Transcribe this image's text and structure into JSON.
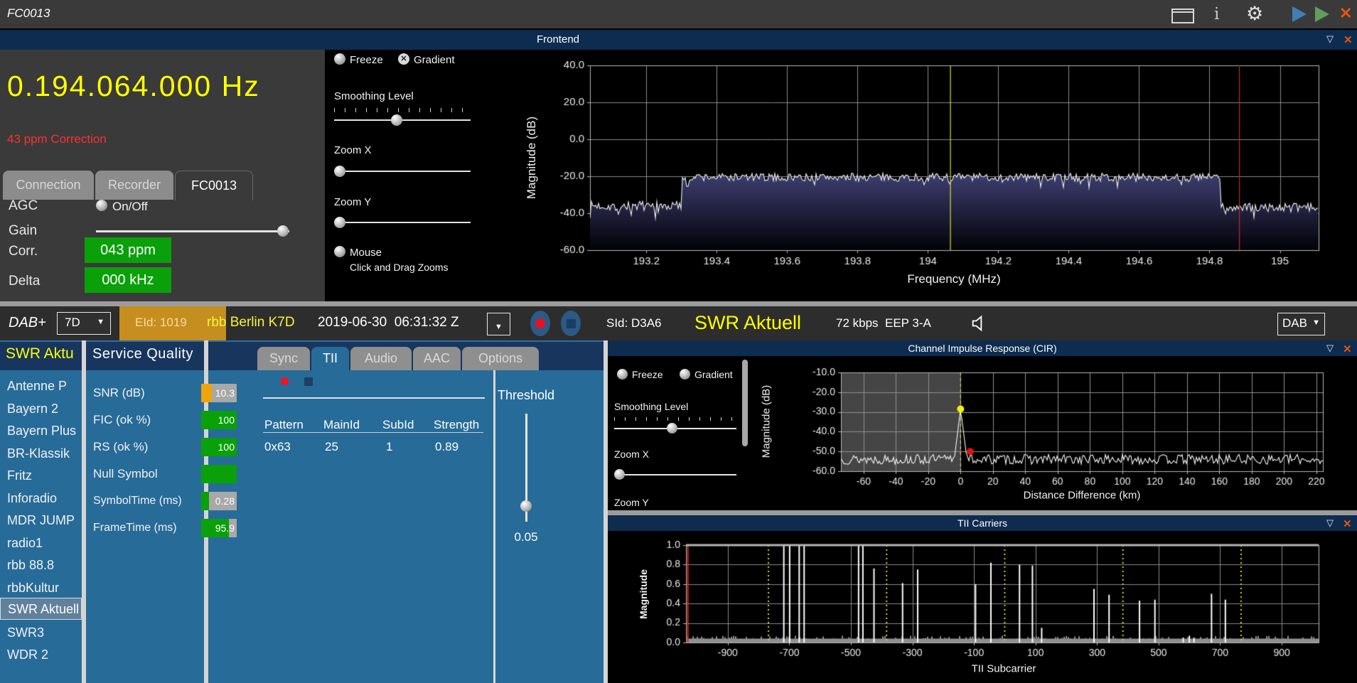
{
  "colors": {
    "accent_yellow": "#ffff00",
    "alert_red": "#ff3030",
    "value_green": "#0aa00a",
    "snr_orange": "#f0a30a",
    "steel_blue_panel": "#276b99",
    "navy_header": "#0e2c50",
    "gold_block": "#c68e1e",
    "record_red": "#e81123",
    "close_orange": "#e8540f"
  },
  "icons": {
    "info": "i",
    "gear": "⚙",
    "close_x": "✕",
    "collapse_triangle": "▽",
    "dropdown_arrow": "▼",
    "gradient_checked": "✕",
    "record_dot": "",
    "stop_square": ""
  },
  "titlebar": {
    "title": "FC0013"
  },
  "frontend": {
    "header_title": "Frontend",
    "frequency": "0.194.064.000 Hz",
    "correction": "43 ppm Correction",
    "tabs": [
      "Connection",
      "Recorder",
      "FC0013"
    ],
    "active_tab": "FC0013",
    "rows": {
      "agc_label": "AGC",
      "agc_option": "On/Off",
      "gain_label": "Gain",
      "corr_label": "Corr.",
      "corr_value": "043 ppm",
      "delta_label": "Delta",
      "delta_value": "000 kHz"
    },
    "controls": {
      "freeze_label": "Freeze",
      "gradient_label": "Gradient",
      "smoothing_label": "Smoothing Level",
      "zoom_x_label": "Zoom X",
      "zoom_y_label": "Zoom Y",
      "mouse_label": "Mouse",
      "mouse_sublabel": "Click and Drag Zooms"
    }
  },
  "dab_bar": {
    "mode": "DAB+",
    "channel": "7D",
    "eid": "EId: 1019",
    "ensemble": "rbb Berlin K7D",
    "timestamp": "2019-06-30  06:31:32 Z",
    "sid": "SId: D3A6",
    "service": "SWR Aktuell",
    "bitrate_protection": "72 kbps  EEP 3-A",
    "output_mode": "DAB"
  },
  "sidebar": {
    "title": "SWR Aktu",
    "selected_index": 10,
    "items": [
      "Antenne P",
      "Bayern 2",
      "Bayern Plus",
      "BR-Klassik",
      "Fritz",
      "Inforadio",
      "MDR JUMP",
      "radio1",
      "rbb 88.8",
      "rbbKultur",
      "SWR Aktuell",
      "SWR3",
      "WDR 2"
    ]
  },
  "service_quality": {
    "title": "Service Quality",
    "rows": [
      {
        "label": "SNR (dB)",
        "value": "10.3",
        "fill_pct": 30,
        "fill_color": "#f0a30a",
        "track_color": "#a8a8a8"
      },
      {
        "label": "FIC (ok %)",
        "value": "100",
        "fill_pct": 100,
        "fill_color": "#0aa00a",
        "track_color": "#a8a8a8"
      },
      {
        "label": "RS (ok %)",
        "value": "100",
        "fill_pct": 100,
        "fill_color": "#0aa00a",
        "track_color": "#a8a8a8"
      },
      {
        "label": "Null Symbol",
        "value": "",
        "fill_pct": 100,
        "fill_color": "#0aa00a",
        "track_color": "#a8a8a8"
      },
      {
        "label": "SymbolTime (ms)",
        "value": "0.28",
        "fill_pct": 22,
        "fill_color": "#0aa00a",
        "track_color": "#a8a8a8"
      },
      {
        "label": "FrameTime (ms)",
        "value": "95.9",
        "fill_pct": 78,
        "fill_color": "#0aa00a",
        "track_color": "#a8a8a8"
      }
    ]
  },
  "tii_panel": {
    "tabs": [
      "Sync",
      "TII",
      "Audio",
      "AAC",
      "Options"
    ],
    "active_tab": "TII",
    "table": {
      "headers": [
        "Pattern",
        "MainId",
        "SubId",
        "Strength"
      ],
      "rows": [
        [
          "0x63",
          "25",
          "1",
          "0.89"
        ]
      ]
    },
    "threshold_label": "Threshold",
    "threshold_value": "0.05"
  },
  "cir_panel": {
    "title": "Channel Impulse Response (CIR)",
    "controls": {
      "freeze_label": "Freeze",
      "gradient_label": "Gradient",
      "smoothing_label": "Smoothing Level",
      "zoom_x_label": "Zoom X",
      "zoom_y_label": "Zoom Y"
    }
  },
  "tii_carriers_panel": {
    "title": "TII Carriers"
  },
  "chart_data": [
    {
      "id": "spectrum",
      "type": "area",
      "ylabel": "Magnitude (dB)",
      "xlabel": "Frequency (MHz)",
      "xlim": [
        193.04,
        195.11
      ],
      "ylim": [
        -60,
        40
      ],
      "xticks": [
        193.2,
        193.4,
        193.6,
        193.8,
        194,
        194.2,
        194.4,
        194.6,
        194.8,
        195
      ],
      "xtick_labels": [
        "193.2",
        "193.4",
        "193.6",
        "193.8",
        "194",
        "194.2",
        "194.4",
        "194.6",
        "194.8",
        "195"
      ],
      "yticks": [
        40,
        20,
        0,
        -20,
        -40,
        -60
      ],
      "ytick_labels": [
        "40.0",
        "20.0",
        "0.0",
        "-20.0",
        "-40.0",
        "-60.0"
      ],
      "grid": true,
      "segments": [
        {
          "from": 193.04,
          "to": 193.3,
          "level": -36,
          "jitter": 2.6
        },
        {
          "from": 193.3,
          "to": 194.83,
          "level": -20.5,
          "jitter": 2.2
        },
        {
          "from": 194.83,
          "to": 195.11,
          "level": -37,
          "jitter": 2.4
        }
      ],
      "markers": [
        {
          "type": "vline",
          "x": 194.064,
          "color": "#cfcf30"
        },
        {
          "type": "vline",
          "x": 194.885,
          "color": "#b82828"
        }
      ]
    },
    {
      "id": "cir",
      "type": "line",
      "ylabel": "Magnitude (dB)",
      "xlabel": "Distance Difference (km)",
      "xlim": [
        -74,
        224
      ],
      "ylim": [
        -60,
        -10
      ],
      "xticks": [
        -60,
        -40,
        -20,
        0,
        20,
        40,
        60,
        80,
        100,
        120,
        140,
        160,
        180,
        200,
        220
      ],
      "xtick_labels": [
        "-60",
        "-40",
        "-20",
        "0",
        "20",
        "40",
        "60",
        "80",
        "100",
        "120",
        "140",
        "160",
        "180",
        "200",
        "220"
      ],
      "yticks": [
        -10,
        -20,
        -30,
        -40,
        -50,
        -60
      ],
      "ytick_labels": [
        "-10.0",
        "-20.0",
        "-30.0",
        "-40.0",
        "-50.0",
        "-60.0"
      ],
      "grid": true,
      "noise_level": -54,
      "noise_jitter": 2.5,
      "peak": {
        "x": 0,
        "y": -28.5
      },
      "shade_region": [
        -74,
        0
      ],
      "markers": [
        {
          "type": "vline_dashed",
          "x": 0,
          "color": "#e0e050"
        },
        {
          "type": "dot",
          "x": 0,
          "y": -28.5,
          "color": "#f2f20a"
        },
        {
          "type": "dot",
          "x": 6,
          "y": -50,
          "color": "#e01212"
        }
      ]
    },
    {
      "id": "tii",
      "type": "stem",
      "ylabel": "Magnitude",
      "xlabel": "TII Subcarrier",
      "xlim": [
        -1036,
        1020
      ],
      "ylim": [
        0,
        1
      ],
      "xticks": [
        -900,
        -700,
        -500,
        -300,
        -100,
        100,
        300,
        500,
        700,
        900
      ],
      "xtick_labels": [
        "-900",
        "-700",
        "-500",
        "-300",
        "-100",
        "100",
        "300",
        "500",
        "700",
        "900"
      ],
      "yticks": [
        1.0,
        0.8,
        0.6,
        0.4,
        0.2,
        0.0
      ],
      "ytick_labels": [
        "1.0",
        "0.8",
        "0.6",
        "0.4",
        "0.2",
        "0.0"
      ],
      "grid": true,
      "dotted_vlines": [
        -768,
        -384,
        0,
        384,
        768
      ],
      "red_vline": -1030,
      "noise_band": 0.04,
      "spikes": [
        [
          -718,
          1.0
        ],
        [
          -699,
          1.0
        ],
        [
          -668,
          1.0
        ],
        [
          -652,
          1.0
        ],
        [
          -475,
          1.0
        ],
        [
          -461,
          1.0
        ],
        [
          -425,
          0.76
        ],
        [
          -332,
          0.61
        ],
        [
          -283,
          0.75
        ],
        [
          -95,
          0.6
        ],
        [
          -45,
          0.82
        ],
        [
          48,
          0.8
        ],
        [
          90,
          0.79
        ],
        [
          120,
          0.15
        ],
        [
          290,
          0.55
        ],
        [
          339,
          0.49
        ],
        [
          438,
          0.43
        ],
        [
          488,
          0.44
        ],
        [
          580,
          0.05
        ],
        [
          600,
          0.07
        ],
        [
          615,
          0.05
        ],
        [
          672,
          0.5
        ],
        [
          717,
          0.44
        ]
      ]
    }
  ]
}
